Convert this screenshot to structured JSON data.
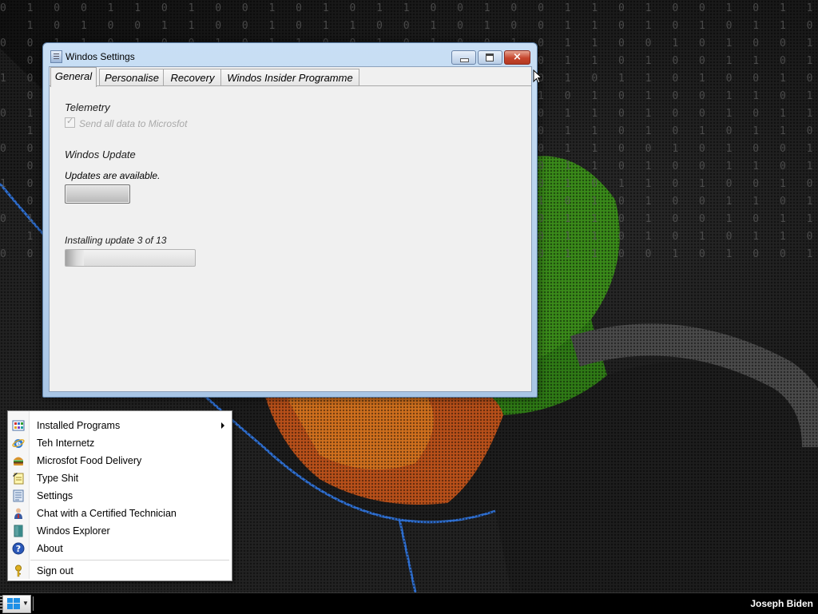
{
  "window": {
    "title": "Windos Settings",
    "close_glyph": "×",
    "tabs": [
      {
        "label": "General",
        "active": true
      },
      {
        "label": "Personalise",
        "active": false
      },
      {
        "label": "Recovery",
        "active": false
      },
      {
        "label": "Windos Insider Programme",
        "active": false
      }
    ],
    "general": {
      "telemetry_heading": "Telemetry",
      "telemetry_checkbox_label": "Send all data to Microsfot",
      "telemetry_checked": true,
      "telemetry_disabled": true,
      "update_heading": "Windos Update",
      "update_status": "Updates are available.",
      "install_status": "Installing update 3 of 13",
      "progress_fraction": 0.14
    }
  },
  "start_menu": {
    "items": [
      {
        "label": "Installed Programs",
        "icon": "installed-programs-icon",
        "has_submenu": true
      },
      {
        "label": "Teh Internetz",
        "icon": "internet-explorer-icon"
      },
      {
        "label": "Microsfot Food Delivery",
        "icon": "burger-icon"
      },
      {
        "label": "Type Shit",
        "icon": "notepad-icon"
      },
      {
        "label": "Settings",
        "icon": "settings-icon"
      },
      {
        "label": "Chat with a Certified Technician",
        "icon": "technician-icon"
      },
      {
        "label": "Windos Explorer",
        "icon": "explorer-icon"
      },
      {
        "label": "About",
        "icon": "help-icon"
      },
      {
        "label": "Sign out",
        "icon": "key-icon"
      }
    ]
  },
  "taskbar": {
    "user_name": "Joseph Biden"
  },
  "colors": {
    "start_logo_blue": "#1e90e6",
    "close_red": "#c6452d",
    "title_bar": "#bcd4ee"
  }
}
